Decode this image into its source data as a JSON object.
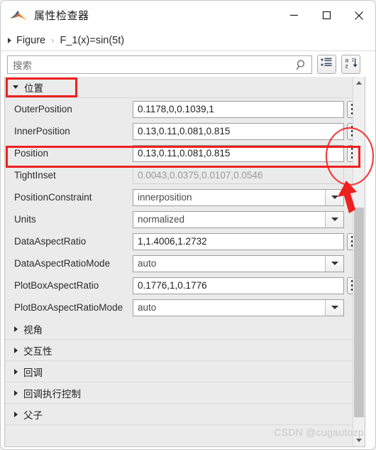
{
  "window": {
    "title": "属性检查器",
    "logo_icon": "matlab-membrane-logo",
    "controls": [
      {
        "name": "minimize",
        "icon": "minimize-icon"
      },
      {
        "name": "maximize",
        "icon": "maximize-icon"
      },
      {
        "name": "close",
        "icon": "close-icon"
      }
    ]
  },
  "breadcrumb": {
    "expander_icon": "triangle-right-icon",
    "items": [
      "Figure",
      "F_1(x)=sin(5t)"
    ],
    "separator": "›"
  },
  "search": {
    "placeholder": "搜索",
    "value": "",
    "icon": "search-icon"
  },
  "toolbar": {
    "buttons": [
      {
        "name": "group-by-category-button",
        "icon": "category-list-icon",
        "label": ""
      },
      {
        "name": "sort-alphabetically-button",
        "icon": "sort-az-icon",
        "label": ""
      }
    ],
    "sort_icon_letters": {
      "top": "a",
      "bottom": "z"
    }
  },
  "panel": {
    "expanded_section": {
      "label": "位置",
      "expanded": true,
      "triangle_icon": "triangle-down-icon"
    },
    "properties": [
      {
        "label": "OuterPosition",
        "value": "0.1178,0,0.1039,1",
        "type": "text",
        "disabled": false,
        "has_dots": true
      },
      {
        "label": "InnerPosition",
        "value": "0.13,0.11,0.081,0.815",
        "type": "text",
        "disabled": false,
        "has_dots": true
      },
      {
        "label": "Position",
        "value": "0.13,0.11,0.081,0.815",
        "type": "text",
        "disabled": false,
        "has_dots": true
      },
      {
        "label": "TightInset",
        "value": "0.0043,0.0375,0.0107,0.0546",
        "type": "text",
        "disabled": true,
        "has_dots": false
      },
      {
        "label": "PositionConstraint",
        "value": "innerposition",
        "type": "combo",
        "disabled": false,
        "has_dots": false
      },
      {
        "label": "Units",
        "value": "normalized",
        "type": "combo",
        "disabled": false,
        "has_dots": false
      },
      {
        "label": "DataAspectRatio",
        "value": "1,1.4006,1.2732",
        "type": "text",
        "disabled": false,
        "has_dots": true
      },
      {
        "label": "DataAspectRatioMode",
        "value": "auto",
        "type": "combo",
        "disabled": false,
        "has_dots": false
      },
      {
        "label": "PlotBoxAspectRatio",
        "value": "0.1776,1,0.1776",
        "type": "text",
        "disabled": false,
        "has_dots": true
      },
      {
        "label": "PlotBoxAspectRatioMode",
        "value": "auto",
        "type": "combo",
        "disabled": false,
        "has_dots": false
      }
    ],
    "collapsed_sections": [
      {
        "label": "视角",
        "triangle_icon": "triangle-right-icon"
      },
      {
        "label": "交互性",
        "triangle_icon": "triangle-right-icon"
      },
      {
        "label": "回调",
        "triangle_icon": "triangle-right-icon"
      },
      {
        "label": "回调执行控制",
        "triangle_icon": "triangle-right-icon"
      },
      {
        "label": "父子",
        "triangle_icon": "triangle-right-icon"
      }
    ],
    "scrollbar": {
      "up_icon": "scroll-up-arrow-icon",
      "down_icon": "scroll-down-arrow-icon"
    }
  },
  "annotations": {
    "color": "#ef2020",
    "shapes": [
      "rect-around-section-header",
      "rect-around-position-row",
      "ellipse-around-dots-button",
      "arrow-pointing-to-dots-button"
    ]
  },
  "watermark": {
    "text": "CSDN @cugautozp"
  }
}
